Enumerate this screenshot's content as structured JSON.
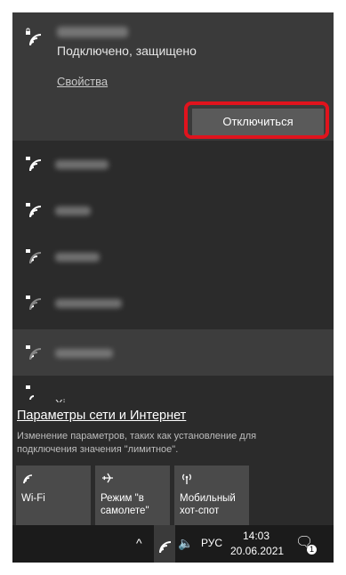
{
  "connected_network": {
    "status": "Подключено, защищено",
    "properties_link": "Свойства",
    "disconnect_button": "Отключиться"
  },
  "networks": [
    {
      "secured": true
    },
    {
      "secured": true
    },
    {
      "secured": true
    },
    {
      "secured": true
    },
    {
      "secured": true
    }
  ],
  "partial_network_label": "Xi",
  "settings": {
    "link": "Параметры сети и Интернет",
    "description": "Изменение параметров, таких как установление для подключения значения \"лимитное\"."
  },
  "quick_actions": [
    {
      "label": "Wi-Fi",
      "icon": "wifi-icon"
    },
    {
      "label": "Режим \"в самолете\"",
      "icon": "airplane-icon"
    },
    {
      "label": "Мобильный хот-спот",
      "icon": "hotspot-icon"
    }
  ],
  "taskbar": {
    "language": "РУС",
    "time": "14:03",
    "date": "20.06.2021",
    "notification_count": "1"
  },
  "colors": {
    "highlight": "#e0131d"
  }
}
